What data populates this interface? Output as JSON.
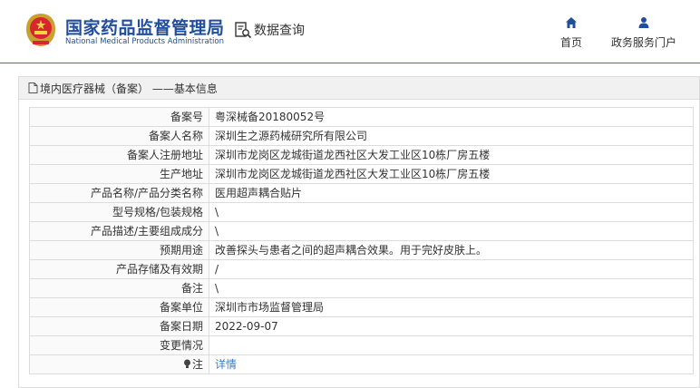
{
  "header": {
    "site_name_cn": "国家药品监督管理局",
    "site_name_en": "National Medical Products Administration",
    "query_label": "数据查询",
    "nav": {
      "home_label": "首页",
      "gov_label": "政务服务门户"
    }
  },
  "panel": {
    "title": "境内医疗器械（备案） ——基本信息",
    "rows": [
      {
        "key": "备案号",
        "value": "粤深械备20180052号"
      },
      {
        "key": "备案人名称",
        "value": "深圳生之源药械研究所有限公司"
      },
      {
        "key": "备案人注册地址",
        "value": "深圳市龙岗区龙城街道龙西社区大发工业区10栋厂房五楼"
      },
      {
        "key": "生产地址",
        "value": "深圳市龙岗区龙城街道龙西社区大发工业区10栋厂房五楼"
      },
      {
        "key": "产品名称/产品分类名称",
        "value": "医用超声耦合贴片"
      },
      {
        "key": "型号规格/包装规格",
        "value": "\\"
      },
      {
        "key": "产品描述/主要组成成分",
        "value": "\\"
      },
      {
        "key": "预期用途",
        "value": "改善探头与患者之间的超声耦合效果。用于完好皮肤上。"
      },
      {
        "key": "产品存储及有效期",
        "value": "/"
      },
      {
        "key": "备注",
        "value": "\\"
      },
      {
        "key": "备案单位",
        "value": "深圳市市场监督管理局"
      },
      {
        "key": "备案日期",
        "value": "2022-09-07"
      },
      {
        "key": "变更情况",
        "value": ""
      }
    ],
    "note_row": {
      "key": "注",
      "link": "详情"
    }
  },
  "colors": {
    "brand_blue": "#1f4e9c",
    "link_blue": "#3a7cc9",
    "border": "#dcdcdc"
  }
}
